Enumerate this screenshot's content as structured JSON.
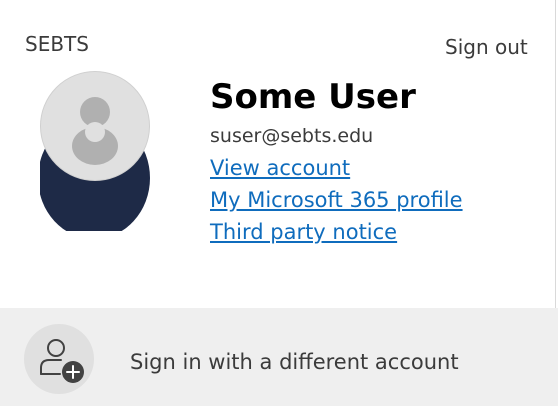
{
  "header": {
    "org_name": "SEBTS",
    "sign_out_label": "Sign out"
  },
  "user": {
    "display_name": "Some User",
    "email": "suser@sebts.edu",
    "avatar_icon": "person-icon"
  },
  "links": {
    "view_account": "View account",
    "microsoft_profile": "My Microsoft 365 profile",
    "third_party_notice": "Third party notice"
  },
  "footer": {
    "different_account_label": "Sign in with a different account",
    "icon": "add-person-icon"
  },
  "colors": {
    "link": "#0f6cbd",
    "text": "#3b3b3b",
    "footer_bg": "#efefef",
    "avatar_bg": "#e0e0e0",
    "avatar_ring": "#1e2a47"
  }
}
